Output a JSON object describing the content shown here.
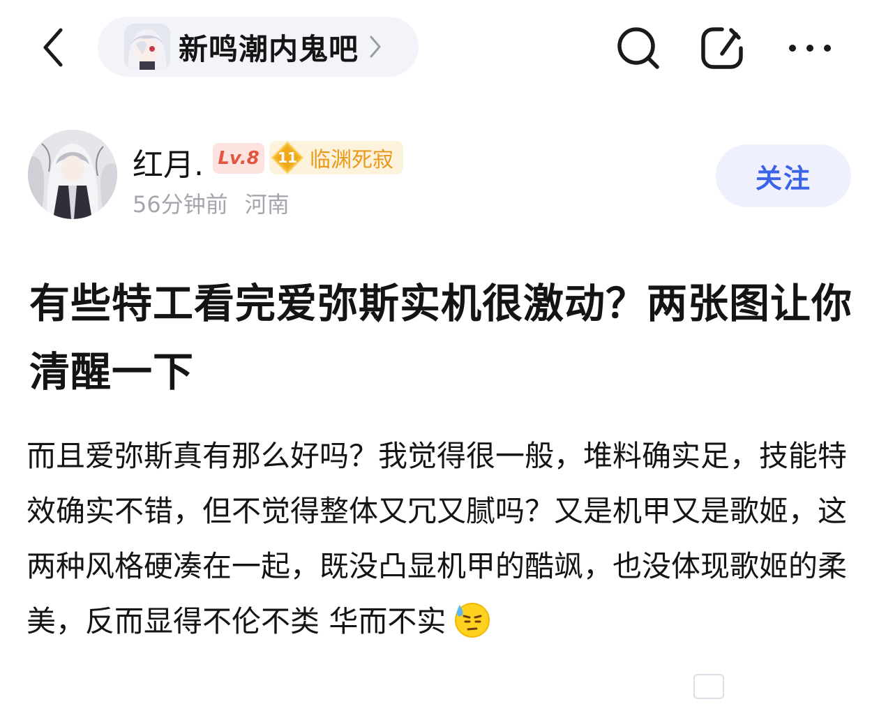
{
  "header": {
    "forum_name": "新鸣潮内鬼吧",
    "icons": [
      "back-arrow-icon",
      "chevron-right-icon",
      "search-icon",
      "share-icon",
      "more-icon"
    ]
  },
  "author": {
    "name": "红月.",
    "level": "Lv.8",
    "title_level": "11",
    "title": "临渊死寂",
    "time": "56分钟前",
    "location": "河南",
    "follow_label": "关注"
  },
  "post": {
    "title": "有些特工看完爱弥斯实机很激动？两张图让你清醒一下",
    "body": "而且爱弥斯真有那么好吗？我觉得很一般，堆料确实足，技能特效确实不错，但不觉得整体又冗又腻吗？又是机甲又是歌姬，这两种风格硬凑在一起，既没凸显机甲的酷飒，也没体现歌姬的柔美，反而显得不伦不类 华而不实"
  },
  "colors": {
    "accent_blue": "#3b63e8",
    "follow_bg": "#eef1fd",
    "level_red": "#e25540",
    "level_bg": "#fde3df",
    "title_gold": "#e89a1d",
    "title_bg": "#fdf3dd",
    "meta_gray": "#a4a6ad",
    "pill_bg": "#f3f4f9"
  }
}
